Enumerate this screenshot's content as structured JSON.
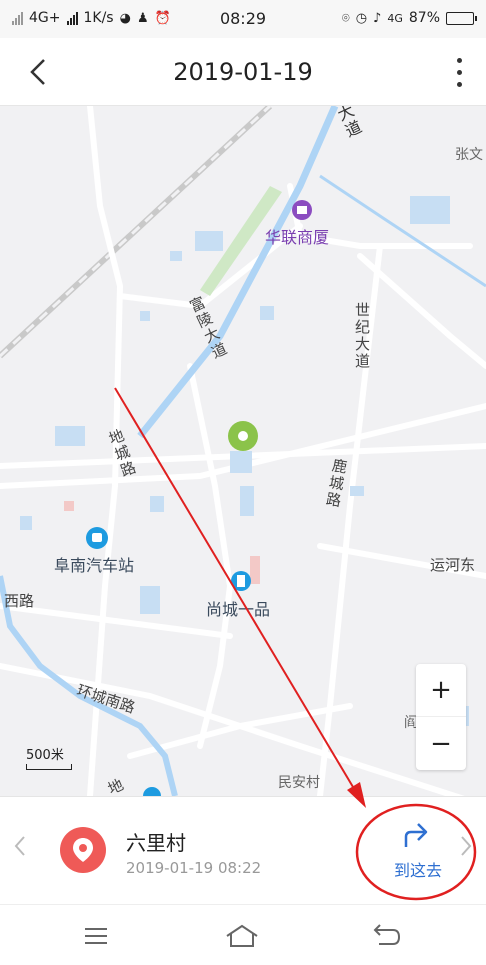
{
  "status_bar": {
    "network": "4G+",
    "speed": "1K/s",
    "time": "08:29",
    "network_right": "4G",
    "battery": "87%"
  },
  "app_bar": {
    "title": "2019-01-19"
  },
  "map": {
    "labels": {
      "dadao_top": "大道",
      "zhangwen": "张文",
      "hualian": "华联商厦",
      "fuling": "富陵大道",
      "shiji": "世纪大道",
      "dicheng": "地城路",
      "lucheng": "鹿城路",
      "funan_station": "阜南汽车站",
      "yunhe": "运河东",
      "xilu": "西路",
      "shangcheng": "尚城一品",
      "huancheng": "环城南路",
      "min_an": "民安村",
      "bottom_road": "地",
      "dian": "阎"
    },
    "zoom_in": "+",
    "zoom_out": "−",
    "scale": "500米"
  },
  "location_card": {
    "name": "六里村",
    "timestamp": "2019-01-19 08:22",
    "go_label": "到这去"
  },
  "colors": {
    "accent_blue": "#2e6fd1",
    "pin_red": "#ef5a57",
    "annotation_red": "#e02020",
    "water": "#aed4f5",
    "poi_purple": "#8b4cc0",
    "poi_green": "#8bc34a",
    "poi_teal": "#1e9be0"
  }
}
